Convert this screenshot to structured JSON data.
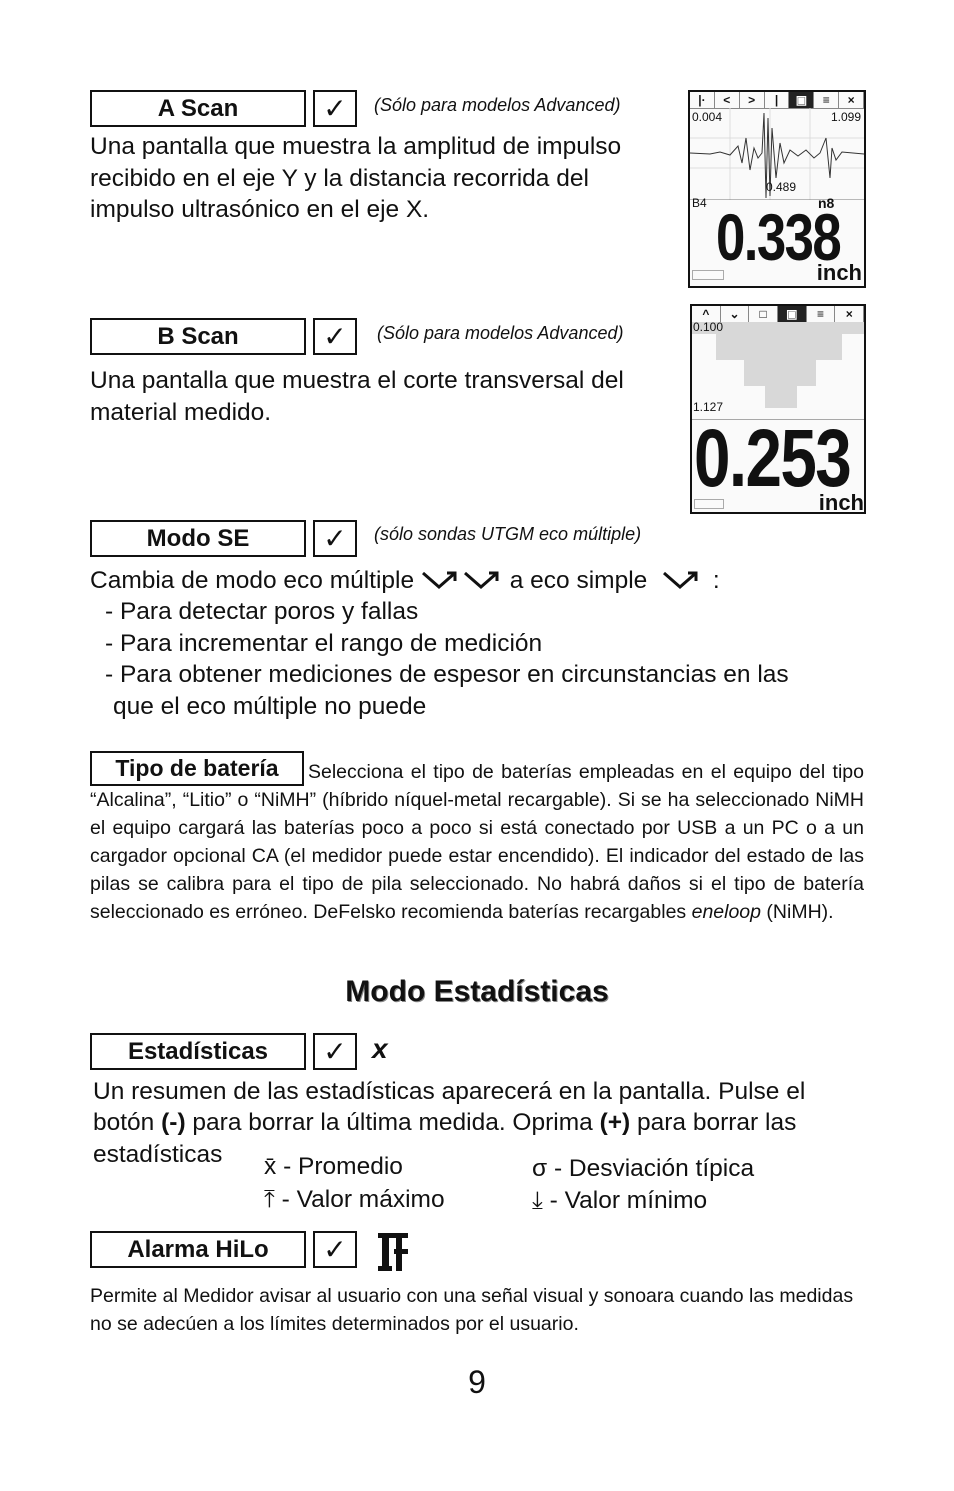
{
  "ascan": {
    "label": "A Scan",
    "check": "✓",
    "note": "(Sólo para modelos Advanced)",
    "text": "Una pantalla que muestra la amplitud de impulso recibido en el eje Y y la distancia recorrida del impulso ultrasónico en el eje X.",
    "screen": {
      "toolbar": [
        "|·",
        "<",
        ">",
        "|",
        "▣",
        "≡",
        "×"
      ],
      "left_val": "0.004",
      "right_val": "1.099",
      "gate_val": "0.489",
      "probe": "B4",
      "n": "n8",
      "reading": "0.338",
      "unit": "inch"
    }
  },
  "bscan": {
    "label": "B Scan",
    "check": "✓",
    "note": "(Sólo para modelos Advanced)",
    "text": "Una pantalla que muestra el corte transversal del material medido.",
    "screen": {
      "toolbar": [
        "^",
        "⌄",
        "□",
        "▣",
        "≡",
        "×"
      ],
      "top_val": "0.100",
      "bottom_val": "1.127",
      "reading": "0.253",
      "unit": "inch"
    }
  },
  "modose": {
    "label": "Modo SE",
    "check": "✓",
    "note": "(sólo sondas UTGM eco múltiple)",
    "line1a": "Cambia de modo eco múltiple",
    "line1b": "a eco simple",
    "line1c": ":",
    "bullets": [
      "- Para detectar poros y fallas",
      "- Para incrementar el rango de medición",
      "- Para obtener mediciones de espesor en circunstancias en las",
      "que el eco múltiple no puede"
    ]
  },
  "bateria": {
    "label": "Tipo de batería",
    "text_first": "Selecciona el tipo de baterías empleadas en el equipo",
    "text_rest": "del tipo “Alcalina”, “Litio” o “NiMH” (híbrido níquel-metal recargable). Si se ha seleccionado NiMH el equipo cargará las baterías poco a poco si está conectado por USB a un PC o a un cargador opcional CA (el medidor puede estar encendido). El indicador del estado de las pilas se calibra para el tipo de pila seleccionado. No habrá daños si el tipo de batería seleccionado es erróneo. DeFelsko recomienda baterías recargables",
    "brand": "eneloop",
    "tail": "(NiMH)."
  },
  "section_title": "Modo Estadísticas",
  "estadisticas": {
    "label": "Estadísticas",
    "check": "✓",
    "icon": "x",
    "p1": "Un resumen de las estadísticas aparecerá en la pantalla. Pulse el",
    "p2a": "botón",
    "p2b": "(-)",
    "p2c": "para borrar la última medida. Oprima",
    "p2d": "(+)",
    "p2e": "para borrar las",
    "p3": "estadísticas",
    "items": [
      {
        "sym": "x̄",
        "text": "- Promedio"
      },
      {
        "sym": "σ",
        "text": "- Desviación típica"
      },
      {
        "sym": "⤒",
        "text": "- Valor máximo"
      },
      {
        "sym": "⤓",
        "text": "- Valor mínimo"
      }
    ]
  },
  "alarma": {
    "label": "Alarma HiLo",
    "check": "✓",
    "text": "Permite al Medidor avisar al usuario con una señal visual y sonoara cuando las medidas no se adecúen a los límites determinados por el usuario."
  },
  "page_number": "9"
}
